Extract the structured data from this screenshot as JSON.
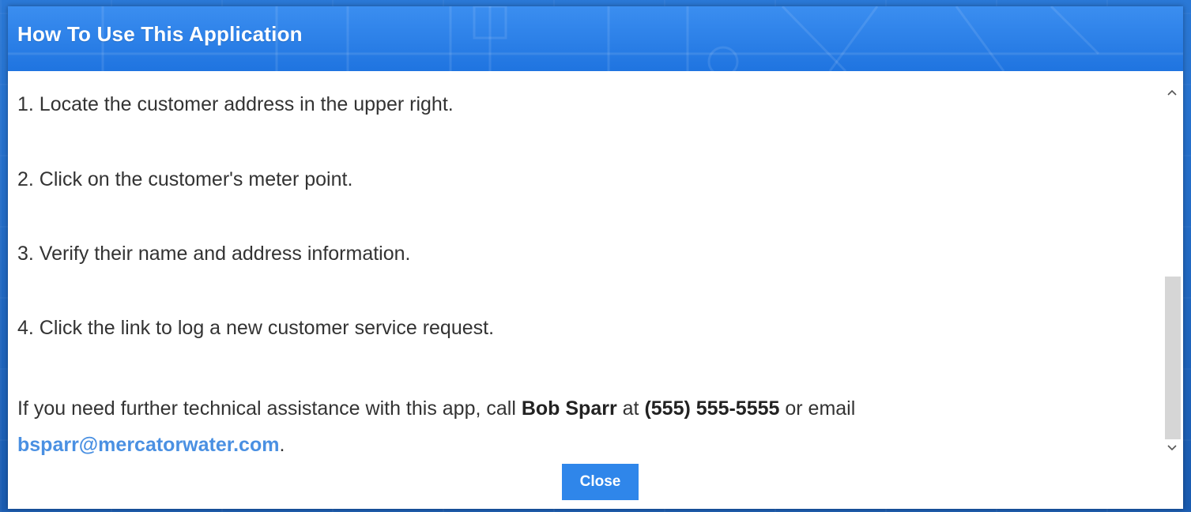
{
  "dialog": {
    "title": "How To Use This Application",
    "steps": [
      "1. Locate the customer address in the upper right.",
      "2. Click on the customer's meter point.",
      "3. Verify their name and address information.",
      "4. Click the link to log a new customer service request."
    ],
    "help": {
      "prefix": "If you need further technical assistance with this app, call ",
      "contact_name": "Bob Sparr",
      "middle": " at ",
      "phone": "(555) 555-5555",
      "suffix": " or email ",
      "email": "bsparr@mercatorwater.com",
      "end": "."
    },
    "close_label": "Close"
  },
  "scrollbar": {
    "up_icon": "chevron-up-icon",
    "down_icon": "chevron-down-icon"
  },
  "colors": {
    "header": "#1f74e0",
    "button": "#2f86ea",
    "link": "#4a90e2"
  }
}
